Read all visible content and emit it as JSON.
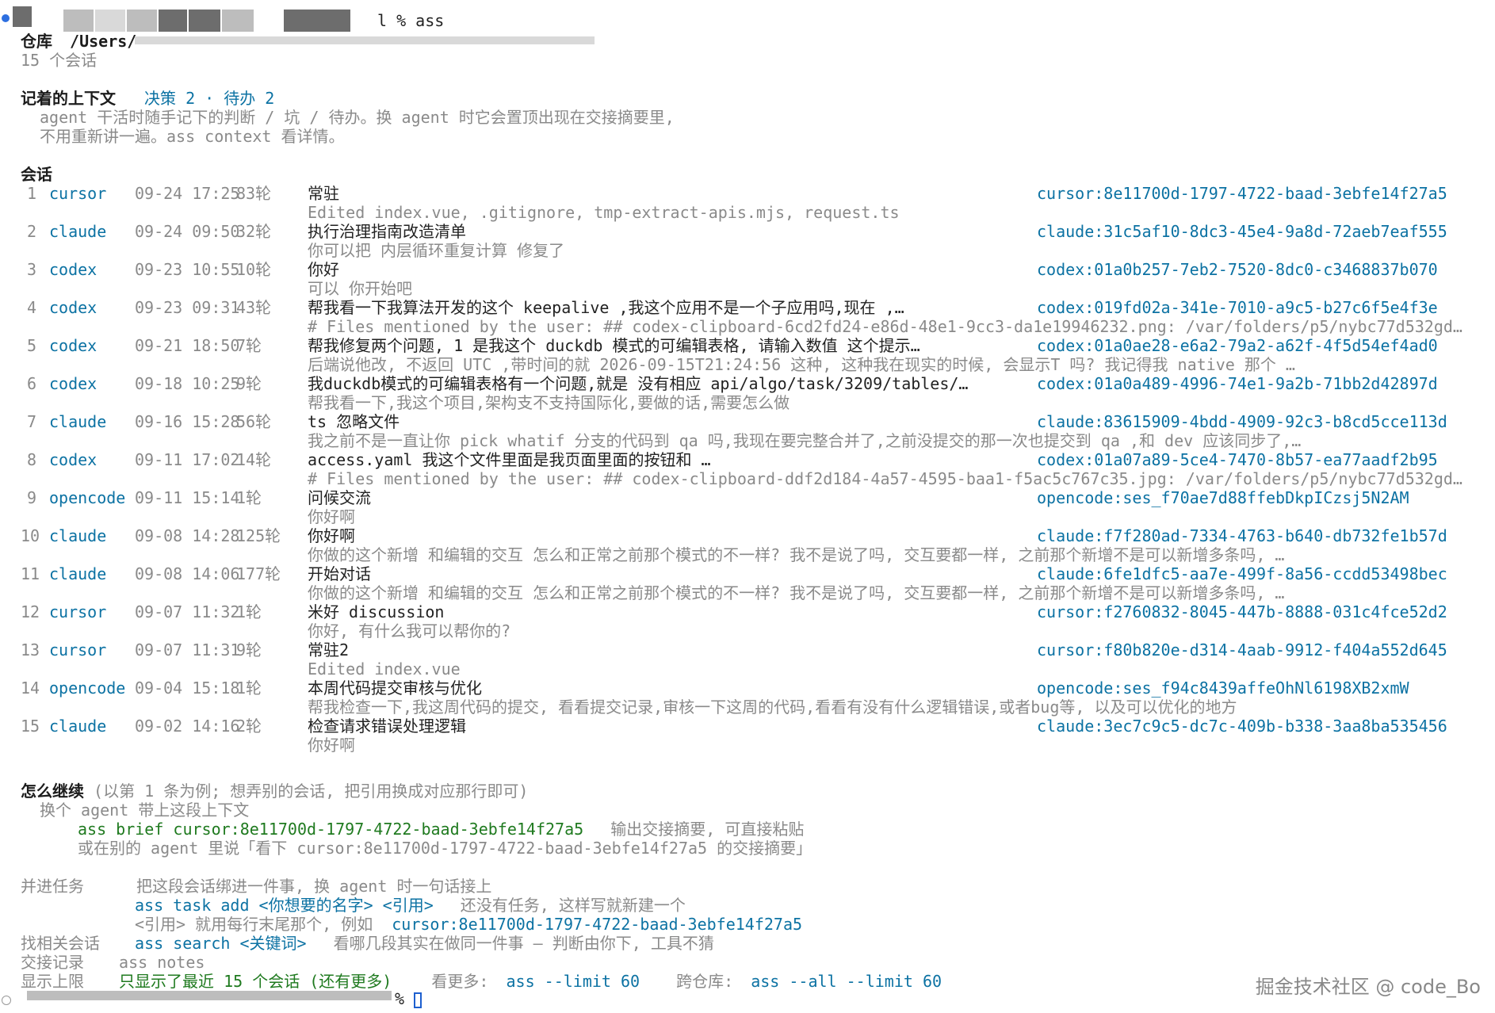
{
  "prompt": {
    "command": "l % ass"
  },
  "repo": {
    "label": "仓库",
    "path": "/Users/"
  },
  "summary": {
    "sessions_count": "15 个会话"
  },
  "context": {
    "title": "记着的上下文",
    "stats": "决策 2 · 待办 2",
    "line1": "agent 干活时随手记下的判断 / 坑 / 待办。换 agent 时它会置顶出现在交接摘要里,",
    "line2": "不用重新讲一遍。ass context 看详情。"
  },
  "sessions": {
    "title": "会话",
    "items": [
      {
        "index": "1",
        "tool": "cursor",
        "time": "09-24 17:25",
        "turns": "83轮",
        "title": "常驻",
        "id": "cursor:8e11700d-1797-4722-baad-3ebfe14f27a5",
        "detail": "Edited index.vue, .gitignore, tmp-extract-apis.mjs, request.ts"
      },
      {
        "index": "2",
        "tool": "claude",
        "time": "09-24 09:50",
        "turns": "32轮",
        "title": "执行治理指南改造清单",
        "id": "claude:31c5af10-8dc3-45e4-9a8d-72aeb7eaf555",
        "detail": "你可以把 内层循环重复计算 修复了"
      },
      {
        "index": "3",
        "tool": "codex",
        "time": "09-23 10:55",
        "turns": "10轮",
        "title": "你好",
        "id": "codex:01a0b257-7eb2-7520-8dc0-c3468837b070",
        "detail": "可以 你开始吧"
      },
      {
        "index": "4",
        "tool": "codex",
        "time": "09-23 09:31",
        "turns": "43轮",
        "title": "帮我看一下我算法开发的这个 keepalive ,我这个应用不是一个子应用吗,现在 ,…",
        "id": "codex:019fd02a-341e-7010-a9c5-b27c6f5e4f3e",
        "detail": "# Files mentioned by the user: ## codex-clipboard-6cd2fd24-e86d-48e1-9cc3-da1e19946232.png: /var/folders/p5/nybc77d532gd…"
      },
      {
        "index": "5",
        "tool": "codex",
        "time": "09-21 18:50",
        "turns": "7轮",
        "title": "帮我修复两个问题, 1 是我这个 duckdb 模式的可编辑表格, 请输入数值 这个提示…",
        "id": "codex:01a0ae28-e6a2-79a2-a62f-4f5d54ef4ad0",
        "detail": "后端说他改, 不返回 UTC ,带时间的就 2026-09-15T21:24:56 这种, 这种我在现实的时候, 会显示T 吗? 我记得我 native 那个 …"
      },
      {
        "index": "6",
        "tool": "codex",
        "time": "09-18 10:25",
        "turns": "9轮",
        "title": "我duckdb模式的可编辑表格有一个问题,就是 没有相应 api/algo/task/3209/tables/…",
        "id": "codex:01a0a489-4996-74e1-9a2b-71bb2d42897d",
        "detail": "帮我看一下,我这个项目,架构支不支持国际化,要做的话,需要怎么做"
      },
      {
        "index": "7",
        "tool": "claude",
        "time": "09-16 15:28",
        "turns": "56轮",
        "title": "ts 忽略文件",
        "id": "claude:83615909-4bdd-4909-92c3-b8cd5cce113d",
        "detail": "我之前不是一直让你 pick whatif 分支的代码到 qa 吗,我现在要完整合并了,之前没提交的那一次也提交到 qa ,和 dev 应该同步了,…"
      },
      {
        "index": "8",
        "tool": "codex",
        "time": "09-11 17:02",
        "turns": "14轮",
        "title": "access.yaml 我这个文件里面是我页面里面的按钮和 …",
        "id": "codex:01a07a89-5ce4-7470-8b57-ea77aadf2b95",
        "detail": "# Files mentioned by the user: ## codex-clipboard-ddf2d184-4a57-4595-baa1-f5ac5c767c35.jpg: /var/folders/p5/nybc77d532gd…"
      },
      {
        "index": "9",
        "tool": "opencode",
        "time": "09-11 15:14",
        "turns": "1轮",
        "title": "问候交流",
        "id": "opencode:ses_f70ae7d88ffebDkpICzsj5N2AM",
        "detail": "你好啊"
      },
      {
        "index": "10",
        "tool": "claude",
        "time": "09-08 14:28",
        "turns": "125轮",
        "title": "你好啊",
        "id": "claude:f7f280ad-7334-4763-b640-db732fe1b57d",
        "detail": "你做的这个新增 和编辑的交互 怎么和正常之前那个模式的不一样? 我不是说了吗, 交互要都一样, 之前那个新增不是可以新增多条吗, …"
      },
      {
        "index": "11",
        "tool": "claude",
        "time": "09-08 14:06",
        "turns": "177轮",
        "title": "开始对话",
        "id": "claude:6fe1dfc5-aa7e-499f-8a56-ccdd53498bec",
        "detail": "你做的这个新增 和编辑的交互 怎么和正常之前那个模式的不一样? 我不是说了吗, 交互要都一样, 之前那个新增不是可以新增多条吗, …"
      },
      {
        "index": "12",
        "tool": "cursor",
        "time": "09-07 11:32",
        "turns": "1轮",
        "title": "米好 discussion",
        "id": "cursor:f2760832-8045-447b-8888-031c4fce52d2",
        "detail": "你好, 有什么我可以帮你的?"
      },
      {
        "index": "13",
        "tool": "cursor",
        "time": "09-07 11:31",
        "turns": "9轮",
        "title": "常驻2",
        "id": "cursor:f80b820e-d314-4aab-9912-f404a552d645",
        "detail": "Edited index.vue"
      },
      {
        "index": "14",
        "tool": "opencode",
        "time": "09-04 15:18",
        "turns": "1轮",
        "title": "本周代码提交审核与优化",
        "id": "opencode:ses_f94c8439affeOhNl6198XB2xmW",
        "detail": "帮我检查一下,我这周代码的提交, 看看提交记录,审核一下这周的代码,看看有没有什么逻辑错误,或者bug等, 以及可以优化的地方"
      },
      {
        "index": "15",
        "tool": "claude",
        "time": "09-02 14:16",
        "turns": "2轮",
        "title": "检查请求错误处理逻辑",
        "id": "claude:3ec7c9c5-dc7c-409b-b338-3aa8ba535456",
        "detail": "你好啊"
      }
    ]
  },
  "continue": {
    "title": "怎么继续",
    "note": "(以第 1 条为例; 想弄别的会话, 把引用换成对应那行即可)",
    "line1": "换个 agent 带上这段上下文",
    "brief_cmd": "ass brief cursor:8e11700d-1797-4722-baad-3ebfe14f27a5",
    "brief_desc": "输出交接摘要, 可直接粘贴",
    "alt_line": "或在别的 agent 里说「看下 cursor:8e11700d-1797-4722-baad-3ebfe14f27a5 的交接摘要」"
  },
  "tasks": {
    "label": "并进任务",
    "desc": "把这段会话绑进一件事, 换 agent 时一句话接上",
    "cmd": "ass task add <你想要的名字> <引用>",
    "cmd_desc": "还没有任务, 这样写就新建一个",
    "ref_line": "<引用> 就用每行末尾那个, 例如",
    "ref_example": "cursor:8e11700d-1797-4722-baad-3ebfe14f27a5"
  },
  "find": {
    "label": "找相关会话",
    "cmd": "ass search <关键词>",
    "desc": "看哪几段其实在做同一件事 — 判断由你下, 工具不猜"
  },
  "notes": {
    "label": "交接记录",
    "cmd": "ass notes"
  },
  "limit": {
    "label": "显示上限",
    "value": "只显示了最近 15 个会话 (还有更多)",
    "more_label": "看更多:",
    "more_cmd": "ass --limit 60",
    "cross_label": "跨仓库:",
    "cross_cmd": "ass --all --limit 60"
  },
  "footer_prompt": "%",
  "watermark": "掘金技术社区 @ code_Bo",
  "colors": {
    "accent": "#0c72a3",
    "green": "#1f7a1f",
    "dim": "#8a8a8a"
  }
}
